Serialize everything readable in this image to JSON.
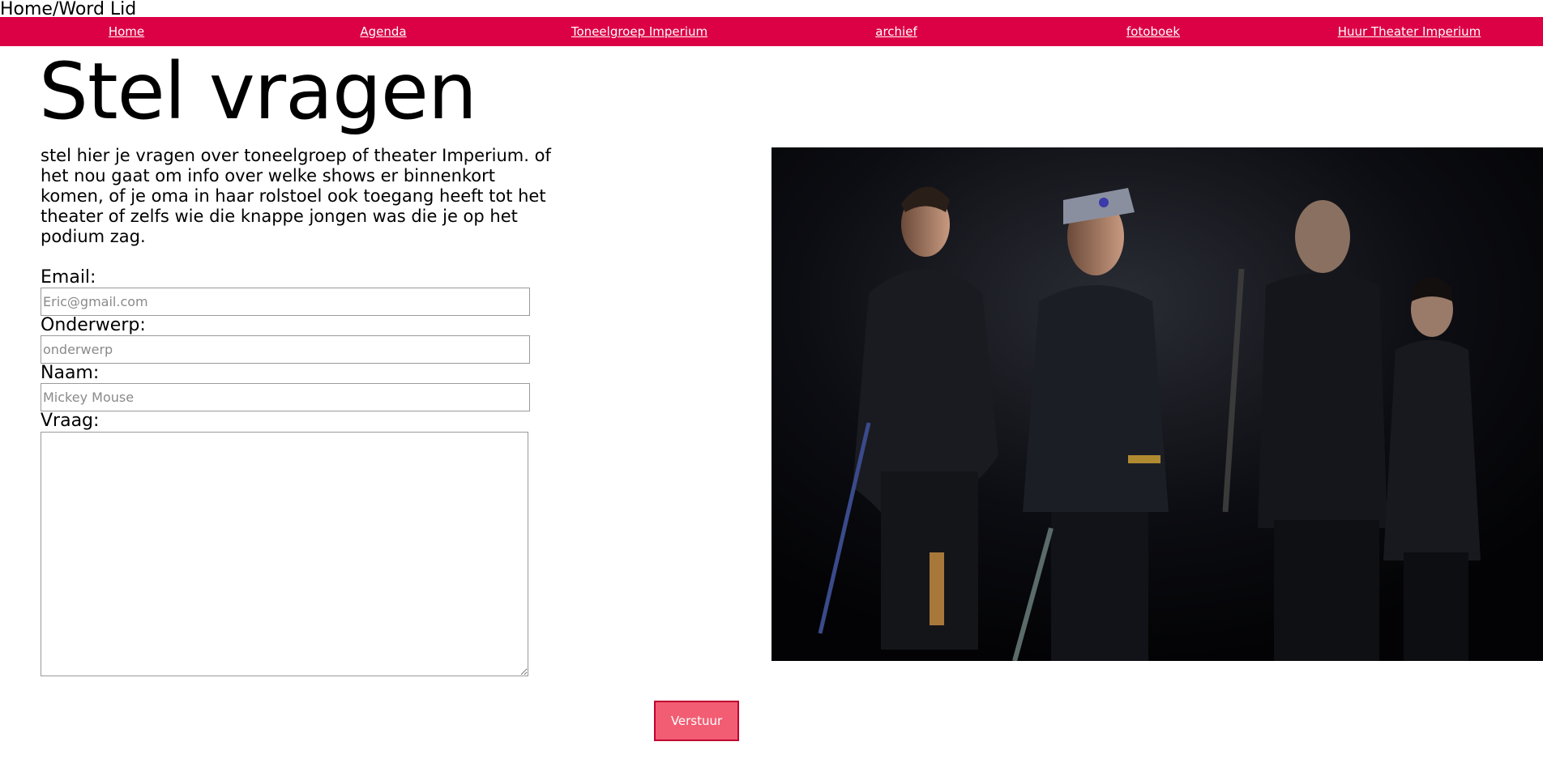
{
  "breadcrumb": "Home/Word Lid",
  "nav": {
    "items": [
      {
        "label": "Home"
      },
      {
        "label": "Agenda"
      },
      {
        "label": "Toneelgroep Imperium"
      },
      {
        "label": "archief"
      },
      {
        "label": "fotoboek"
      },
      {
        "label": "Huur Theater Imperium"
      }
    ]
  },
  "page": {
    "title": "Stel vragen",
    "intro": "stel hier je vragen over toneelgroep of theater Imperium. of het nou gaat om info over welke shows er binnenkort komen, of je oma in haar rolstoel ook toegang heeft tot het theater of zelfs wie die knappe jongen was die je op het podium zag."
  },
  "form": {
    "email_label": "Email:",
    "email_placeholder": "Eric@gmail.com",
    "subject_label": "Onderwerp:",
    "subject_placeholder": "onderwerp",
    "name_label": "Naam:",
    "name_placeholder": "Mickey Mouse",
    "question_label": "Vraag:",
    "submit_label": "Verstuur"
  },
  "colors": {
    "nav_background": "#dc0045",
    "button_background": "#f25d73"
  }
}
